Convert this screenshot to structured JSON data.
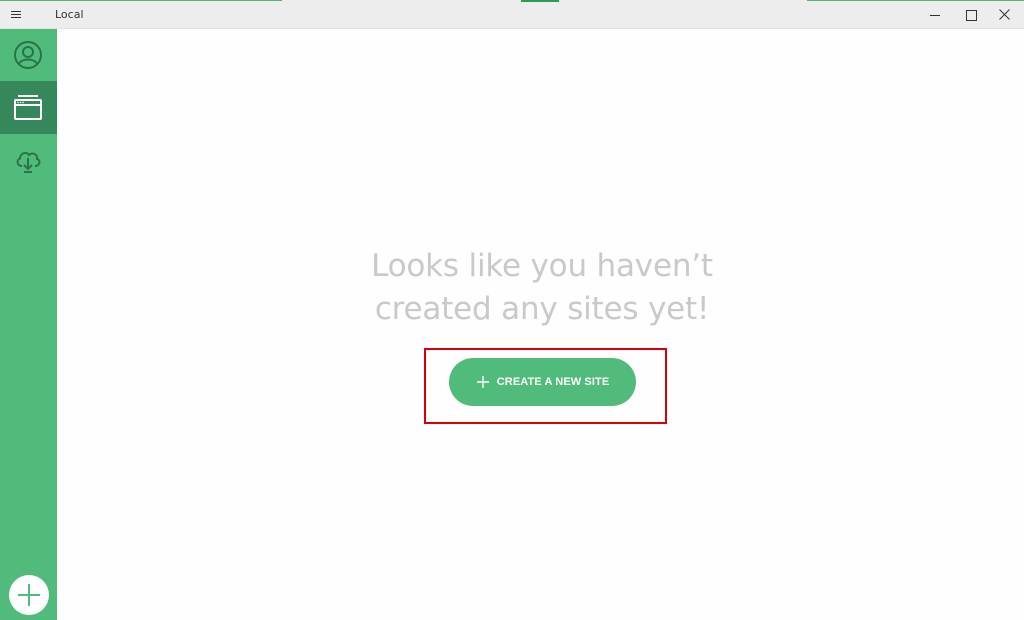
{
  "window": {
    "title": "Local",
    "menu_icon": "hamburger-icon",
    "controls": [
      "minimize-icon",
      "maximize-icon",
      "close-icon"
    ]
  },
  "sidebar": {
    "items": [
      {
        "name": "profile",
        "icon": "user-circle-icon",
        "active": false
      },
      {
        "name": "sites",
        "icon": "browser-window-icon",
        "active": true
      },
      {
        "name": "connect",
        "icon": "cloud-download-icon",
        "active": false
      }
    ],
    "add_icon": "plus-icon"
  },
  "main": {
    "empty_state_line1": "Looks like you haven’t",
    "empty_state_line2": "created any sites yet!",
    "create_button_label": "CREATE A NEW SITE",
    "create_button_icon": "plus-icon"
  },
  "colors": {
    "brand_green": "#51bb7b",
    "active_green": "#36875a",
    "headline_gray": "#c9c9c9",
    "highlight_red": "#d9000d"
  }
}
